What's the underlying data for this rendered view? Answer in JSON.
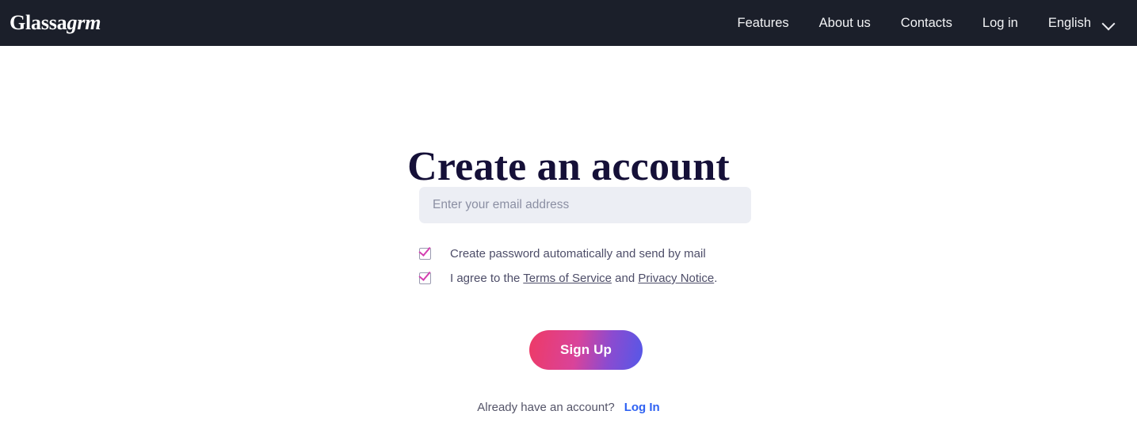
{
  "header": {
    "brand": {
      "primary": "Glassa",
      "secondary": "grm"
    },
    "nav": [
      {
        "label": "Features",
        "name": "nav-item-features"
      },
      {
        "label": "About us",
        "name": "nav-item-about-us"
      },
      {
        "label": "Contacts",
        "name": "nav-item-contacts"
      },
      {
        "label": "Log in",
        "name": "nav-item-log-in"
      }
    ],
    "language": {
      "label": "English",
      "icon": "chevron-down-icon"
    },
    "background_color": "#1b1f2a"
  },
  "main": {
    "title": "Create an account",
    "title_color": "#151038",
    "email": {
      "placeholder": "Enter your email address",
      "value": "",
      "background_color": "#eceef4"
    },
    "options": [
      {
        "checked": true,
        "icon": "checkbox-checked-icon",
        "label": "Create password automatically and send by mail"
      }
    ],
    "terms": {
      "prefix": "I agree to the ",
      "link1": "Terms of Service",
      "middle": " and ",
      "link2": "Privacy Notice",
      "suffix": ".",
      "checked": true,
      "icon": "checkbox-checked-icon"
    },
    "signup_button": {
      "label": "Sign Up",
      "gradient_start": "#ee3a66",
      "gradient_end": "#5458e8"
    },
    "login_prompt": {
      "text": "Already have an account?",
      "link": "Log In",
      "link_color": "#2f62f2"
    }
  }
}
